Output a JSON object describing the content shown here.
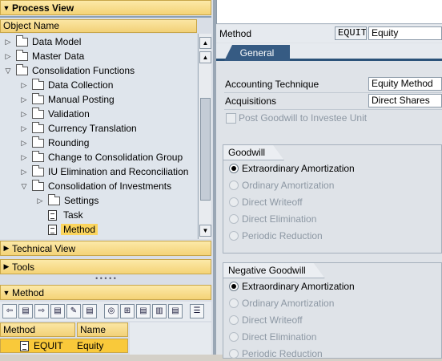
{
  "process_view": {
    "title": "Process View",
    "column": "Object Name"
  },
  "tree": [
    {
      "label": "Data Model",
      "level": 0,
      "kind": "folder",
      "expanded": false
    },
    {
      "label": "Master Data",
      "level": 0,
      "kind": "folder",
      "expanded": false
    },
    {
      "label": "Consolidation Functions",
      "level": 0,
      "kind": "folder",
      "expanded": true
    },
    {
      "label": "Data Collection",
      "level": 1,
      "kind": "folder",
      "expanded": false
    },
    {
      "label": "Manual Posting",
      "level": 1,
      "kind": "folder",
      "expanded": false
    },
    {
      "label": "Validation",
      "level": 1,
      "kind": "folder",
      "expanded": false
    },
    {
      "label": "Currency Translation",
      "level": 1,
      "kind": "folder",
      "expanded": false
    },
    {
      "label": "Rounding",
      "level": 1,
      "kind": "folder",
      "expanded": false
    },
    {
      "label": "Change to Consolidation Group",
      "level": 1,
      "kind": "folder",
      "expanded": false
    },
    {
      "label": "IU Elimination and Reconciliation",
      "level": 1,
      "kind": "folder",
      "expanded": false
    },
    {
      "label": "Consolidation of Investments",
      "level": 1,
      "kind": "folder",
      "expanded": true
    },
    {
      "label": "Settings",
      "level": 2,
      "kind": "folder",
      "expanded": false
    },
    {
      "label": "Task",
      "level": 2,
      "kind": "doc"
    },
    {
      "label": "Method",
      "level": 2,
      "kind": "doc",
      "selected": true
    }
  ],
  "technical_view": {
    "title": "Technical View"
  },
  "tools": {
    "title": "Tools"
  },
  "method_panel": {
    "title": "Method",
    "columns": [
      "Method",
      "Name"
    ],
    "rows": [
      {
        "method": "EQUIT",
        "name": "Equity"
      }
    ]
  },
  "toolbar_icons": [
    "arrow-left-icon",
    "arrow-right-icon",
    "pencil-icon",
    "binoculars-icon",
    "find-next-icon",
    "chart-icon",
    "list-icon"
  ],
  "detail": {
    "method_label": "Method",
    "method_code": "EQUIT",
    "method_name": "Equity",
    "tab": "General",
    "accounting_technique_label": "Accounting Technique",
    "accounting_technique_value": "Equity Method",
    "acquisitions_label": "Acquisitions",
    "acquisitions_value": "Direct Shares",
    "post_goodwill_label": "Post Goodwill to Investee Unit",
    "goodwill": {
      "title": "Goodwill",
      "options": [
        {
          "label": "Extraordinary Amortization",
          "selected": true,
          "enabled": true
        },
        {
          "label": "Ordinary Amortization",
          "selected": false,
          "enabled": false
        },
        {
          "label": "Direct Writeoff",
          "selected": false,
          "enabled": false
        },
        {
          "label": "Direct Elimination",
          "selected": false,
          "enabled": false
        },
        {
          "label": "Periodic Reduction",
          "selected": false,
          "enabled": false
        }
      ]
    },
    "negative_goodwill": {
      "title": "Negative Goodwill",
      "options": [
        {
          "label": "Extraordinary Amortization",
          "selected": true,
          "enabled": true
        },
        {
          "label": "Ordinary Amortization",
          "selected": false,
          "enabled": false
        },
        {
          "label": "Direct Writeoff",
          "selected": false,
          "enabled": false
        },
        {
          "label": "Direct Elimination",
          "selected": false,
          "enabled": false
        },
        {
          "label": "Periodic Reduction",
          "selected": false,
          "enabled": false
        }
      ]
    }
  },
  "colors": {
    "selection": "#f9c93a",
    "tab": "#365b83",
    "panel_header": "#f4d377"
  }
}
